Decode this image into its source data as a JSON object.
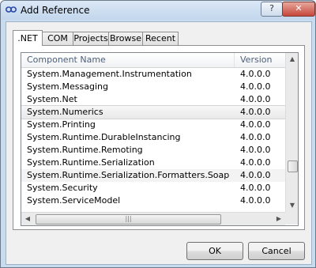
{
  "window": {
    "title": "Add Reference",
    "help_label": "?",
    "close_label": "✕",
    "icon": "reference-icon"
  },
  "tabs": [
    {
      "label": ".NET",
      "active": true
    },
    {
      "label": "COM",
      "active": false
    },
    {
      "label": "Projects",
      "active": false
    },
    {
      "label": "Browse",
      "active": false
    },
    {
      "label": "Recent",
      "active": false
    }
  ],
  "list": {
    "columns": [
      "Component Name",
      "Version"
    ],
    "rows": [
      {
        "name": "System.Management.Instrumentation",
        "version": "4.0.0.0"
      },
      {
        "name": "System.Messaging",
        "version": "4.0.0.0"
      },
      {
        "name": "System.Net",
        "version": "4.0.0.0"
      },
      {
        "name": "System.Numerics",
        "version": "4.0.0.0",
        "state": "selected"
      },
      {
        "name": "System.Printing",
        "version": "4.0.0.0"
      },
      {
        "name": "System.Runtime.DurableInstancing",
        "version": "4.0.0.0"
      },
      {
        "name": "System.Runtime.Remoting",
        "version": "4.0.0.0"
      },
      {
        "name": "System.Runtime.Serialization",
        "version": "4.0.0.0"
      },
      {
        "name": "System.Runtime.Serialization.Formatters.Soap",
        "version": "4.0.0.0",
        "state": "hover"
      },
      {
        "name": "System.Security",
        "version": "4.0.0.0"
      },
      {
        "name": "System.ServiceModel",
        "version": "4.0.0.0"
      }
    ]
  },
  "buttons": {
    "ok": "OK",
    "cancel": "Cancel"
  }
}
